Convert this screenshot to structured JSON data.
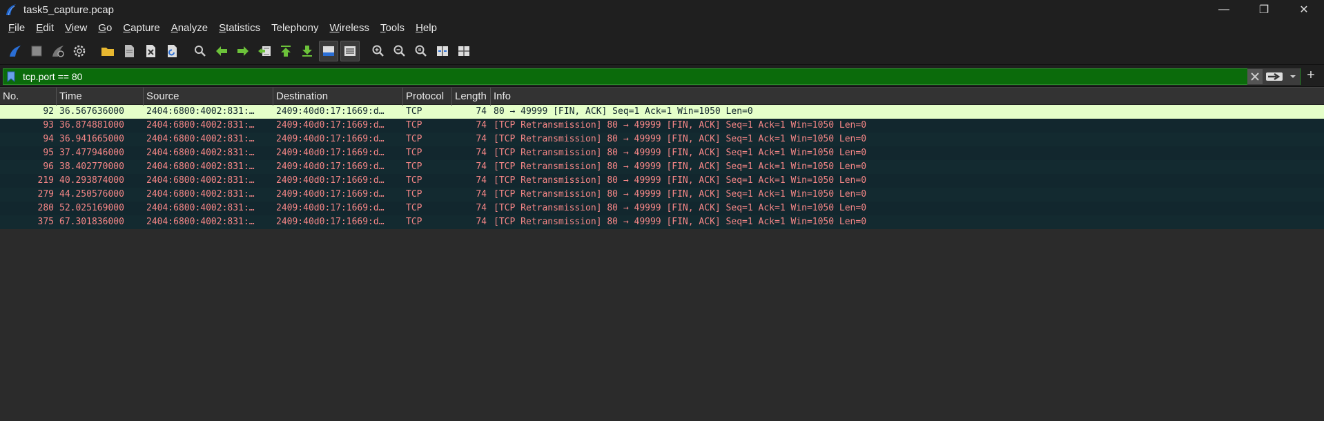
{
  "window": {
    "title": "task5_capture.pcap",
    "minimize": "—",
    "restore": "❐",
    "close": "✕"
  },
  "menu": [
    {
      "label": "File",
      "key": "F",
      "rest": "ile"
    },
    {
      "label": "Edit",
      "key": "E",
      "rest": "dit"
    },
    {
      "label": "View",
      "key": "V",
      "rest": "iew"
    },
    {
      "label": "Go",
      "key": "G",
      "rest": "o"
    },
    {
      "label": "Capture",
      "key": "C",
      "rest": "apture"
    },
    {
      "label": "Analyze",
      "key": "A",
      "rest": "nalyze"
    },
    {
      "label": "Statistics",
      "key": "S",
      "rest": "tatistics"
    },
    {
      "label": "Telephony",
      "key": "",
      "rest": "Telephony"
    },
    {
      "label": "Wireless",
      "key": "W",
      "rest": "ireless"
    },
    {
      "label": "Tools",
      "key": "T",
      "rest": "ools"
    },
    {
      "label": "Help",
      "key": "H",
      "rest": "elp"
    }
  ],
  "filter": {
    "value": "tcp.port == 80",
    "plus": "+"
  },
  "columns": {
    "no": "No.",
    "time": "Time",
    "source": "Source",
    "destination": "Destination",
    "protocol": "Protocol",
    "length": "Length",
    "info": "Info"
  },
  "packets": [
    {
      "no": "92",
      "time": "36.567636000",
      "source": "2404:6800:4002:831:…",
      "destination": "2409:40d0:17:1669:d…",
      "protocol": "TCP",
      "length": "74",
      "info": "80 → 49999 [FIN, ACK] Seq=1 Ack=1 Win=1050 Len=0",
      "selected": true
    },
    {
      "no": "93",
      "time": "36.874881000",
      "source": "2404:6800:4002:831:…",
      "destination": "2409:40d0:17:1669:d…",
      "protocol": "TCP",
      "length": "74",
      "info": "[TCP Retransmission] 80 → 49999 [FIN, ACK] Seq=1 Ack=1 Win=1050 Len=0",
      "selected": false
    },
    {
      "no": "94",
      "time": "36.941665000",
      "source": "2404:6800:4002:831:…",
      "destination": "2409:40d0:17:1669:d…",
      "protocol": "TCP",
      "length": "74",
      "info": "[TCP Retransmission] 80 → 49999 [FIN, ACK] Seq=1 Ack=1 Win=1050 Len=0",
      "selected": false
    },
    {
      "no": "95",
      "time": "37.477946000",
      "source": "2404:6800:4002:831:…",
      "destination": "2409:40d0:17:1669:d…",
      "protocol": "TCP",
      "length": "74",
      "info": "[TCP Retransmission] 80 → 49999 [FIN, ACK] Seq=1 Ack=1 Win=1050 Len=0",
      "selected": false
    },
    {
      "no": "96",
      "time": "38.402770000",
      "source": "2404:6800:4002:831:…",
      "destination": "2409:40d0:17:1669:d…",
      "protocol": "TCP",
      "length": "74",
      "info": "[TCP Retransmission] 80 → 49999 [FIN, ACK] Seq=1 Ack=1 Win=1050 Len=0",
      "selected": false
    },
    {
      "no": "219",
      "time": "40.293874000",
      "source": "2404:6800:4002:831:…",
      "destination": "2409:40d0:17:1669:d…",
      "protocol": "TCP",
      "length": "74",
      "info": "[TCP Retransmission] 80 → 49999 [FIN, ACK] Seq=1 Ack=1 Win=1050 Len=0",
      "selected": false
    },
    {
      "no": "279",
      "time": "44.250576000",
      "source": "2404:6800:4002:831:…",
      "destination": "2409:40d0:17:1669:d…",
      "protocol": "TCP",
      "length": "74",
      "info": "[TCP Retransmission] 80 → 49999 [FIN, ACK] Seq=1 Ack=1 Win=1050 Len=0",
      "selected": false
    },
    {
      "no": "280",
      "time": "52.025169000",
      "source": "2404:6800:4002:831:…",
      "destination": "2409:40d0:17:1669:d…",
      "protocol": "TCP",
      "length": "74",
      "info": "[TCP Retransmission] 80 → 49999 [FIN, ACK] Seq=1 Ack=1 Win=1050 Len=0",
      "selected": false
    },
    {
      "no": "375",
      "time": "67.301836000",
      "source": "2404:6800:4002:831:…",
      "destination": "2409:40d0:17:1669:d…",
      "protocol": "TCP",
      "length": "74",
      "info": "[TCP Retransmission] 80 → 49999 [FIN, ACK] Seq=1 Ack=1 Win=1050 Len=0",
      "selected": false
    }
  ],
  "colors": {
    "selected_bg": "#e5ffc9",
    "retrans_bg": "#12272e",
    "retrans_fg": "#f78787",
    "filter_bg": "#0b6b0b"
  }
}
